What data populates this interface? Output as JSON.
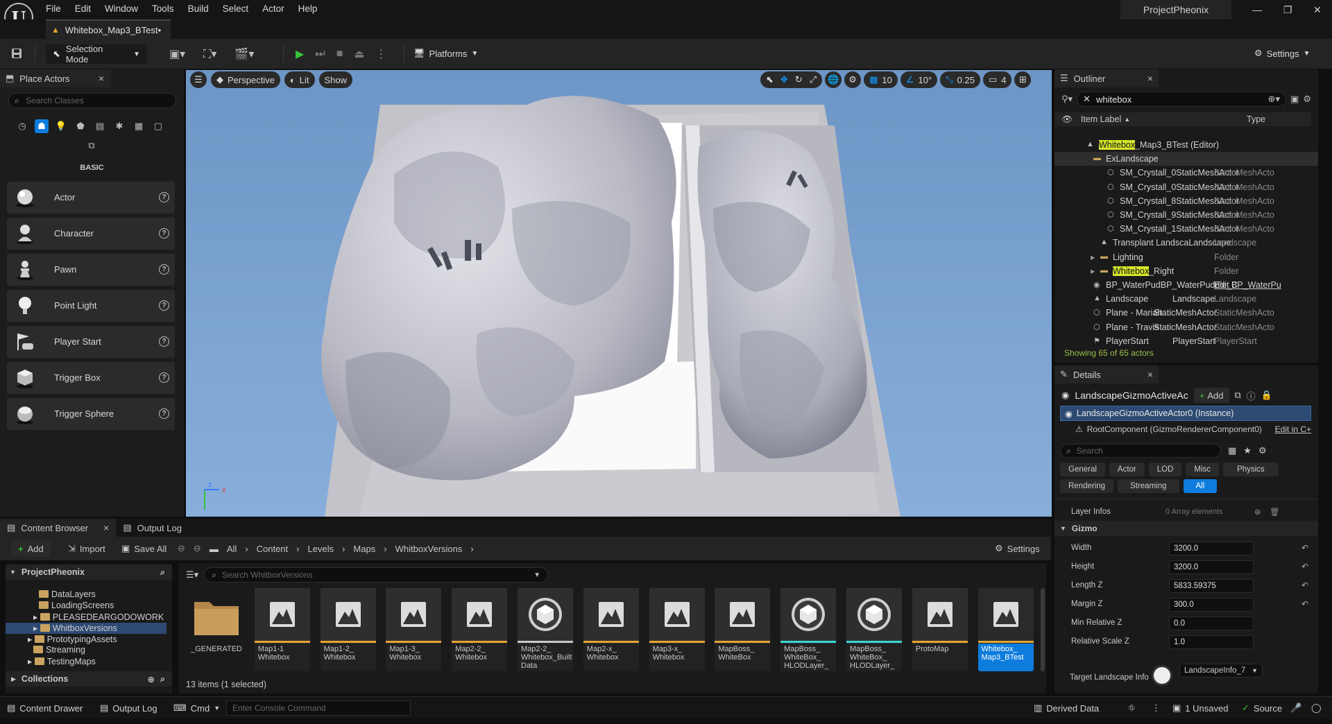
{
  "app": {
    "logo_letter": "U",
    "menu": [
      "File",
      "Edit",
      "Window",
      "Tools",
      "Build",
      "Select",
      "Actor",
      "Help"
    ],
    "project_name": "ProjectPheonix",
    "level_tab": "Whitebox_Map3_BTest•"
  },
  "toolbar": {
    "selection_mode": "Selection Mode",
    "platforms": "Platforms",
    "settings": "Settings"
  },
  "place_actors": {
    "title": "Place Actors",
    "search_placeholder": "Search Classes",
    "section": "BASIC",
    "items": [
      "Actor",
      "Character",
      "Pawn",
      "Point Light",
      "Player Start",
      "Trigger Box",
      "Trigger Sphere"
    ]
  },
  "viewport": {
    "perspective": "Perspective",
    "lit": "Lit",
    "show": "Show",
    "grid_snap": "10",
    "rot_snap": "10°",
    "scale_snap": "0.25",
    "cam_speed": "4",
    "gizmo_z": "z",
    "gizmo_x": "x"
  },
  "outliner": {
    "title": "Outliner",
    "search_value": "whitebox",
    "col_label": "Item Label",
    "col_type": "Type",
    "rows": [
      {
        "pre": "",
        "hl": "Whitebox",
        "post": "_Map3_BTest (Editor)",
        "mid": "",
        "type": ""
      },
      {
        "pre": "ExLandscape",
        "hl": "",
        "post": "",
        "mid": "",
        "type": ""
      },
      {
        "pre": "SM_Crystall_0StaticMeshActor",
        "hl": "",
        "post": "",
        "mid": "",
        "type": "StaticMeshActo"
      },
      {
        "pre": "SM_Crystall_0StaticMeshActor",
        "hl": "",
        "post": "",
        "mid": "",
        "type": "StaticMeshActo"
      },
      {
        "pre": "SM_Crystall_8StaticMeshActor",
        "hl": "",
        "post": "",
        "mid": "",
        "type": "StaticMeshActo"
      },
      {
        "pre": "SM_Crystall_9StaticMeshActor",
        "hl": "",
        "post": "",
        "mid": "",
        "type": "StaticMeshActo"
      },
      {
        "pre": "SM_Crystall_1StaticMeshActor",
        "hl": "",
        "post": "",
        "mid": "",
        "type": "StaticMeshActo"
      },
      {
        "pre": "Transplant LandscaLandscape",
        "hl": "",
        "post": "",
        "mid": "",
        "type": "Landscape"
      },
      {
        "pre": "Lighting",
        "hl": "",
        "post": "",
        "mid": "",
        "type": "Folder"
      },
      {
        "pre": "",
        "hl": "Whitebox",
        "post": "_Right",
        "mid": "",
        "type": "Folder"
      },
      {
        "pre": "BP_WaterPudBP_WaterPuddle_C",
        "hl": "",
        "post": "",
        "mid": "",
        "type": "Edit BP_WaterPu"
      },
      {
        "pre": "Landscape",
        "hl": "",
        "post": "",
        "mid": "Landscape",
        "type": "Landscape"
      },
      {
        "pre": "Plane - Mariah",
        "hl": "",
        "post": "",
        "mid": "StaticMeshActor",
        "type": "StaticMeshActo"
      },
      {
        "pre": "Plane - Travis",
        "hl": "",
        "post": "",
        "mid": "StaticMeshActor",
        "type": "StaticMeshActo"
      },
      {
        "pre": "PlayerStart",
        "hl": "",
        "post": "",
        "mid": "PlayerStart",
        "type": "PlayerStart"
      }
    ],
    "status": "Showing 65 of 65 actors"
  },
  "details": {
    "title": "Details",
    "actor_name": "LandscapeGizmoActiveAc",
    "add": "Add",
    "instance": "LandscapeGizmoActiveActor0 (Instance)",
    "root": "RootComponent (GizmoRendererComponent0)",
    "edit_in": "Edit in C+",
    "search_placeholder": "Search",
    "categories_row1": [
      "General",
      "Actor",
      "LOD",
      "Misc",
      "Physics"
    ],
    "categories_row2": [
      "Rendering",
      "Streaming",
      "All"
    ],
    "layer_infos": "Layer Infos",
    "array_elements": "0 Array elements",
    "gizmo": "Gizmo",
    "props": [
      {
        "label": "Width",
        "value": "3200.0"
      },
      {
        "label": "Height",
        "value": "3200.0"
      },
      {
        "label": "Length Z",
        "value": "5833.59375"
      },
      {
        "label": "Margin Z",
        "value": "300.0"
      },
      {
        "label": "Min Relative Z",
        "value": "0.0"
      },
      {
        "label": "Relative Scale Z",
        "value": "1.0"
      }
    ],
    "target_label": "Target Landscape Info",
    "target_value": "LandscapeInfo_7"
  },
  "content_browser": {
    "tab": "Content Browser",
    "output_tab": "Output Log",
    "add": "Add",
    "import": "Import",
    "save_all": "Save All",
    "breadcrumb": [
      "All",
      "Content",
      "Levels",
      "Maps",
      "WhitboxVersions"
    ],
    "settings": "Settings",
    "project": "ProjectPheonix",
    "tree": [
      "DataLayers",
      "LoadingScreens",
      "PLEASEDEARGODOWORK",
      "WhitboxVersions",
      "PrototypingAssets",
      "Streaming",
      "TestingMaps"
    ],
    "collections": "Collections",
    "search_placeholder": "Search WhitboxVersions",
    "assets": [
      {
        "name": "_GENERATED",
        "kind": "folder"
      },
      {
        "name": "Map1-1 Whitebox",
        "kind": "level"
      },
      {
        "name": "Map1-2_ Whitebox",
        "kind": "level"
      },
      {
        "name": "Map1-3_ Whitebox",
        "kind": "level"
      },
      {
        "name": "Map2-2_ Whitebox",
        "kind": "level"
      },
      {
        "name": "Map2-2_ Whitebox_Built Data",
        "kind": "data"
      },
      {
        "name": "Map2-x_ Whitebox",
        "kind": "level"
      },
      {
        "name": "Map3-x_ Whitebox",
        "kind": "level"
      },
      {
        "name": "MapBoss_ WhiteBox",
        "kind": "level"
      },
      {
        "name": "MapBoss_ WhiteBox_ HLODLayer_",
        "kind": "hlod"
      },
      {
        "name": "MapBoss_ WhiteBox_ HLODLayer_",
        "kind": "hlod"
      },
      {
        "name": "ProtoMap",
        "kind": "level"
      },
      {
        "name": "Whitebox_ Map3_BTest",
        "kind": "selected"
      }
    ],
    "count": "13 items (1 selected)"
  },
  "statusbar": {
    "content_drawer": "Content Drawer",
    "output_log": "Output Log",
    "cmd": "Cmd",
    "console_placeholder": "Enter Console Command",
    "derived_data": "Derived Data",
    "unsaved": "1 Unsaved",
    "source": "Source"
  },
  "colors": {
    "accent_blue": "#0e7cdd",
    "highlight_yellow": "#d5e62b",
    "play_green": "#39c23a",
    "level_orange": "#e6a431",
    "hlod_cyan": "#3ad6d6"
  }
}
